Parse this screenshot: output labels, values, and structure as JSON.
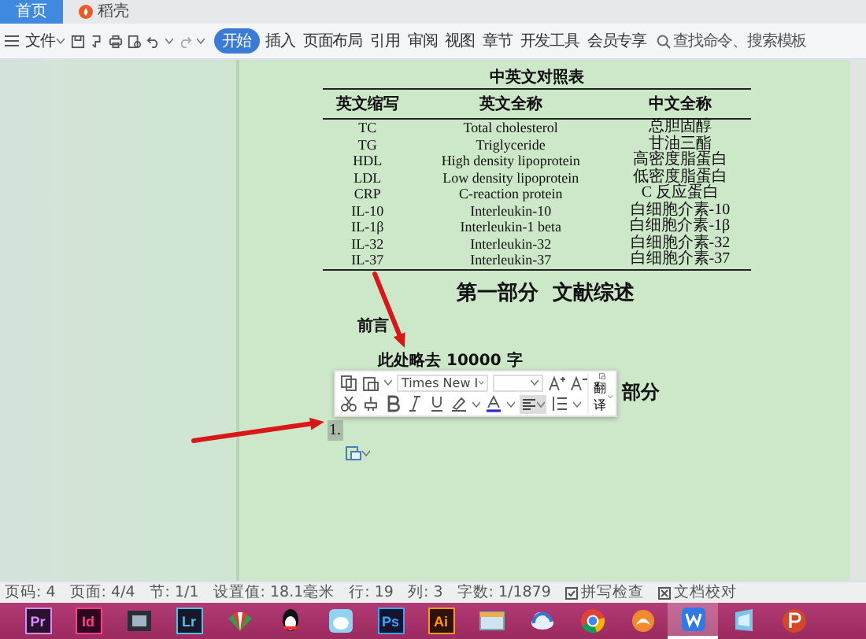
{
  "tabs": [
    {
      "label": "首页",
      "selected": true
    },
    {
      "label": "稻壳",
      "selected": false
    }
  ],
  "menu": {
    "label": "文件"
  },
  "ribbon_tabs": [
    {
      "label": "开始",
      "selected": true
    },
    {
      "label": "插入",
      "selected": false
    },
    {
      "label": "页面布局",
      "selected": false
    },
    {
      "label": "引用",
      "selected": false
    },
    {
      "label": "审阅",
      "selected": false
    },
    {
      "label": "视图",
      "selected": false
    },
    {
      "label": "章节",
      "selected": false
    },
    {
      "label": "开发工具",
      "selected": false
    },
    {
      "label": "会员专享",
      "selected": false
    }
  ],
  "search": {
    "placeholder": "查找命令、搜索模板"
  },
  "document": {
    "table": {
      "title": "中英文对照表",
      "columns": [
        "英文缩写",
        "英文全称",
        "中文全称"
      ],
      "rows": [
        [
          "TC",
          "Total cholesterol",
          "总胆固醇"
        ],
        [
          "TG",
          "Triglyceride",
          "甘油三酯"
        ],
        [
          "HDL",
          "High density lipoprotein",
          "高密度脂蛋白"
        ],
        [
          "LDL",
          "Low density lipoprotein",
          "低密度脂蛋白"
        ],
        [
          "CRP",
          "C-reaction protein",
          "C 反应蛋白"
        ],
        [
          "IL-10",
          "Interleukin-10",
          "白细胞介素-10"
        ],
        [
          "IL-1β",
          "Interleukin-1 beta",
          "白细胞介素-1β"
        ],
        [
          "IL-32",
          "Interleukin-32",
          "白细胞介素-32"
        ],
        [
          "IL-37",
          "Interleukin-37",
          "白细胞介素-37"
        ]
      ]
    },
    "heading": "第一部分  文献综述",
    "subheading": "前言",
    "paragraph": "此处略去 10000 字",
    "partial_heading": "部分",
    "list_marker": "1."
  },
  "mini_toolbar": {
    "font": "Times New I",
    "translate": "翻译",
    "align_pressed": true
  },
  "status_bar": {
    "items": [
      "页码: 4",
      "页面: 4/4",
      "节: 1/1",
      "设置值: 18.1毫米",
      "行: 19",
      "列: 3",
      "字数: 1/1879"
    ],
    "spell_check": "拼写检查",
    "proofread": "文档校对"
  },
  "taskbar": {
    "apps": [
      {
        "kind": "badge",
        "label": "Pr",
        "color": "#d68cff",
        "selected": false
      },
      {
        "kind": "badge",
        "label": "Id",
        "color": "#ff3d8b",
        "selected": false
      },
      {
        "kind": "film",
        "selected": false
      },
      {
        "kind": "badge",
        "label": "Lr",
        "color": "#4fc3e8",
        "selected": false
      },
      {
        "kind": "fan",
        "selected": false
      },
      {
        "kind": "penguin",
        "selected": false
      },
      {
        "kind": "bird",
        "selected": false
      },
      {
        "kind": "badge",
        "label": "Ps",
        "color": "#31a8ff",
        "selected": false
      },
      {
        "kind": "badge",
        "label": "Ai",
        "color": "#ff9a00",
        "selected": false
      },
      {
        "kind": "window",
        "selected": false
      },
      {
        "kind": "cloud",
        "selected": false
      },
      {
        "kind": "chrome",
        "selected": false
      },
      {
        "kind": "fox",
        "selected": false
      },
      {
        "kind": "writer",
        "selected": true
      },
      {
        "kind": "tablet",
        "selected": false
      },
      {
        "kind": "slides",
        "selected": false
      }
    ]
  }
}
